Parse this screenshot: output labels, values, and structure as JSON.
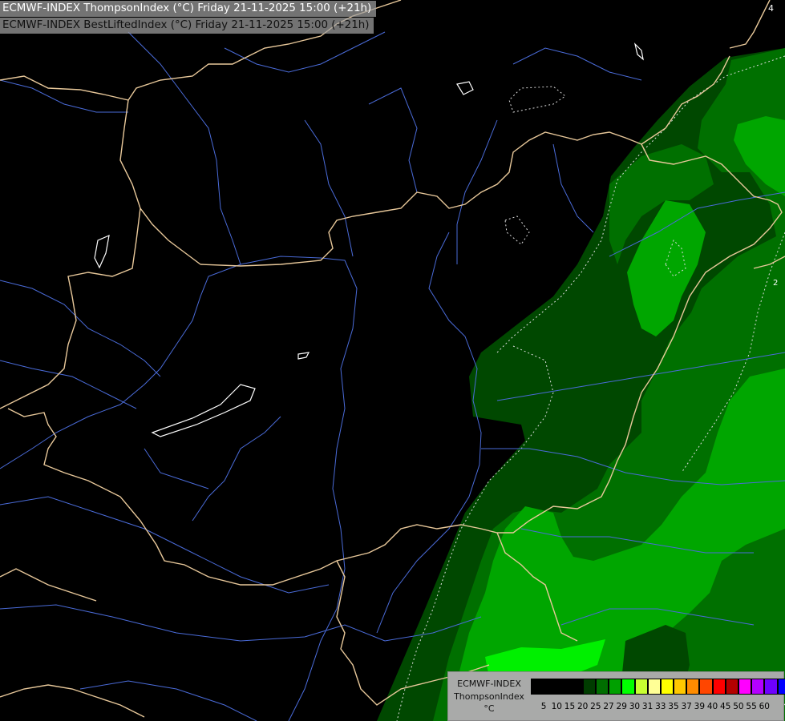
{
  "titles": {
    "line1": "ECMWF-INDEX ThompsonIndex (°C) Friday 21-11-2025 15:00 (+21h)",
    "line2": "ECMWF-INDEX BestLiftedIndex (°C) Friday 21-11-2025 15:00 (+21h)"
  },
  "contour_labels": [
    "4",
    "2"
  ],
  "legend": {
    "model": "ECMWF-INDEX",
    "param": "ThompsonIndex",
    "unit": "°C",
    "levels": [
      "5",
      "10",
      "15",
      "20",
      "25",
      "27",
      "29",
      "30",
      "31",
      "33",
      "35",
      "37",
      "39",
      "40",
      "45",
      "50",
      "55",
      "60"
    ],
    "colors": [
      "#000000",
      "#000000",
      "#000000",
      "#000000",
      "#003c00",
      "#006e00",
      "#00a000",
      "#00ff00",
      "#c8ff32",
      "#ffff96",
      "#ffff00",
      "#ffc800",
      "#ff8c00",
      "#ff4600",
      "#ff0000",
      "#b40000",
      "#ff00ff",
      "#b400ff",
      "#6e00ff",
      "#0000ff"
    ]
  },
  "colors": {
    "field_dark": "#004800",
    "field_mid": "#007000",
    "field_light": "#00a600",
    "field_bright": "#00f000",
    "border": "#e8c89a",
    "river": "#4a6bd8"
  }
}
